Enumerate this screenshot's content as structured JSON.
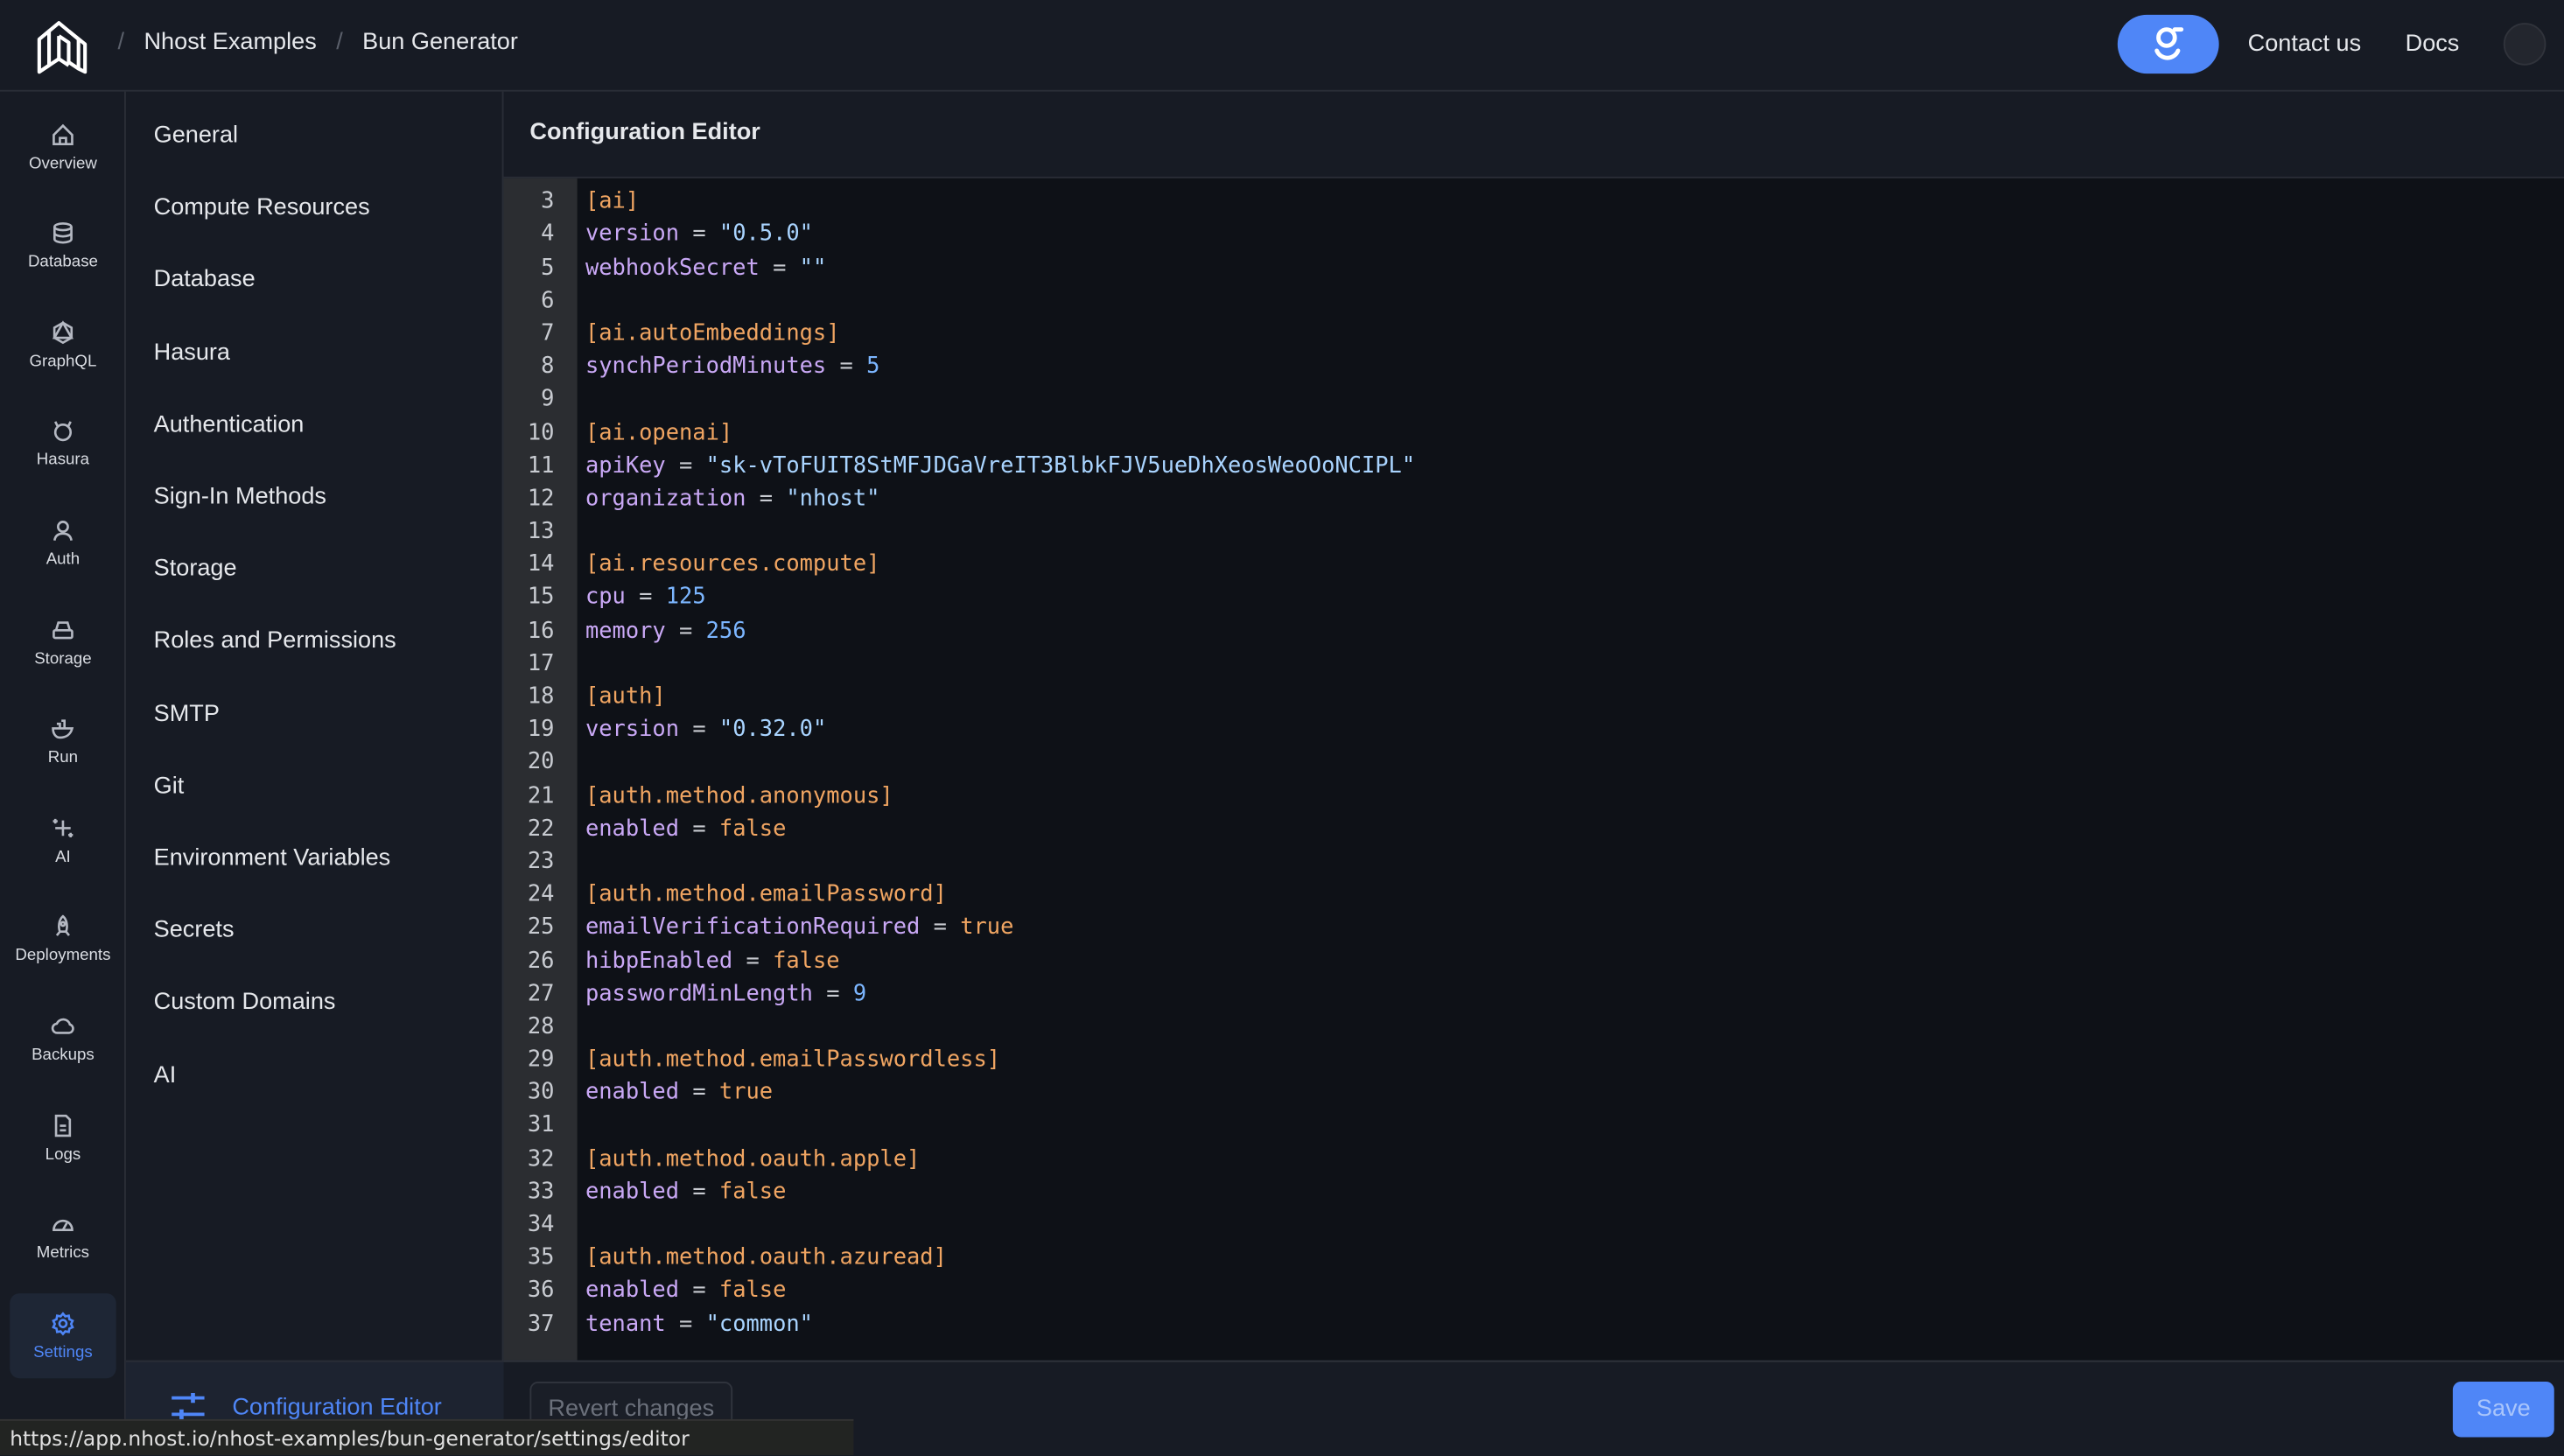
{
  "header": {
    "breadcrumbs": [
      "Nhost Examples",
      "Bun Generator"
    ],
    "contact": "Contact us",
    "docs": "Docs",
    "accent": "#4f86f7"
  },
  "rail": [
    {
      "label": "Overview",
      "icon": "home-icon"
    },
    {
      "label": "Database",
      "icon": "database-icon"
    },
    {
      "label": "GraphQL",
      "icon": "graphql-icon"
    },
    {
      "label": "Hasura",
      "icon": "hasura-icon"
    },
    {
      "label": "Auth",
      "icon": "user-icon"
    },
    {
      "label": "Storage",
      "icon": "storage-icon"
    },
    {
      "label": "Run",
      "icon": "docker-icon"
    },
    {
      "label": "AI",
      "icon": "sparkles-icon"
    },
    {
      "label": "Deployments",
      "icon": "rocket-icon"
    },
    {
      "label": "Backups",
      "icon": "cloud-icon"
    },
    {
      "label": "Logs",
      "icon": "file-icon"
    },
    {
      "label": "Metrics",
      "icon": "gauge-icon"
    },
    {
      "label": "Settings",
      "icon": "gear-icon",
      "active": true
    }
  ],
  "subnav": [
    "General",
    "Compute Resources",
    "Database",
    "Hasura",
    "Authentication",
    "Sign-In Methods",
    "Storage",
    "Roles and Permissions",
    "SMTP",
    "Git",
    "Environment Variables",
    "Secrets",
    "Custom Domains",
    "AI"
  ],
  "subnav_active": "Configuration Editor",
  "editor": {
    "title": "Configuration Editor",
    "first_line": 2,
    "lines": [
      "",
      "[ai]",
      "version = \"0.5.0\"",
      "webhookSecret = \"\"",
      "",
      "[ai.autoEmbeddings]",
      "synchPeriodMinutes = 5",
      "",
      "[ai.openai]",
      "apiKey = \"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\"",
      "organization = \"nhost\"",
      "",
      "[ai.resources.compute]",
      "cpu = 125",
      "memory = 256",
      "",
      "[auth]",
      "version = \"0.32.0\"",
      "",
      "[auth.method.anonymous]",
      "enabled = false",
      "",
      "[auth.method.emailPassword]",
      "emailVerificationRequired = true",
      "hibpEnabled = false",
      "passwordMinLength = 9",
      "",
      "[auth.method.emailPasswordless]",
      "enabled = true",
      "",
      "[auth.method.oauth.apple]",
      "enabled = false",
      "",
      "[auth.method.oauth.azuread]",
      "enabled = false",
      "tenant = \"common\""
    ]
  },
  "footer": {
    "revert": "Revert changes",
    "save": "Save"
  },
  "status_url": "https://app.nhost.io/nhost-examples/bun-generator/settings/editor"
}
